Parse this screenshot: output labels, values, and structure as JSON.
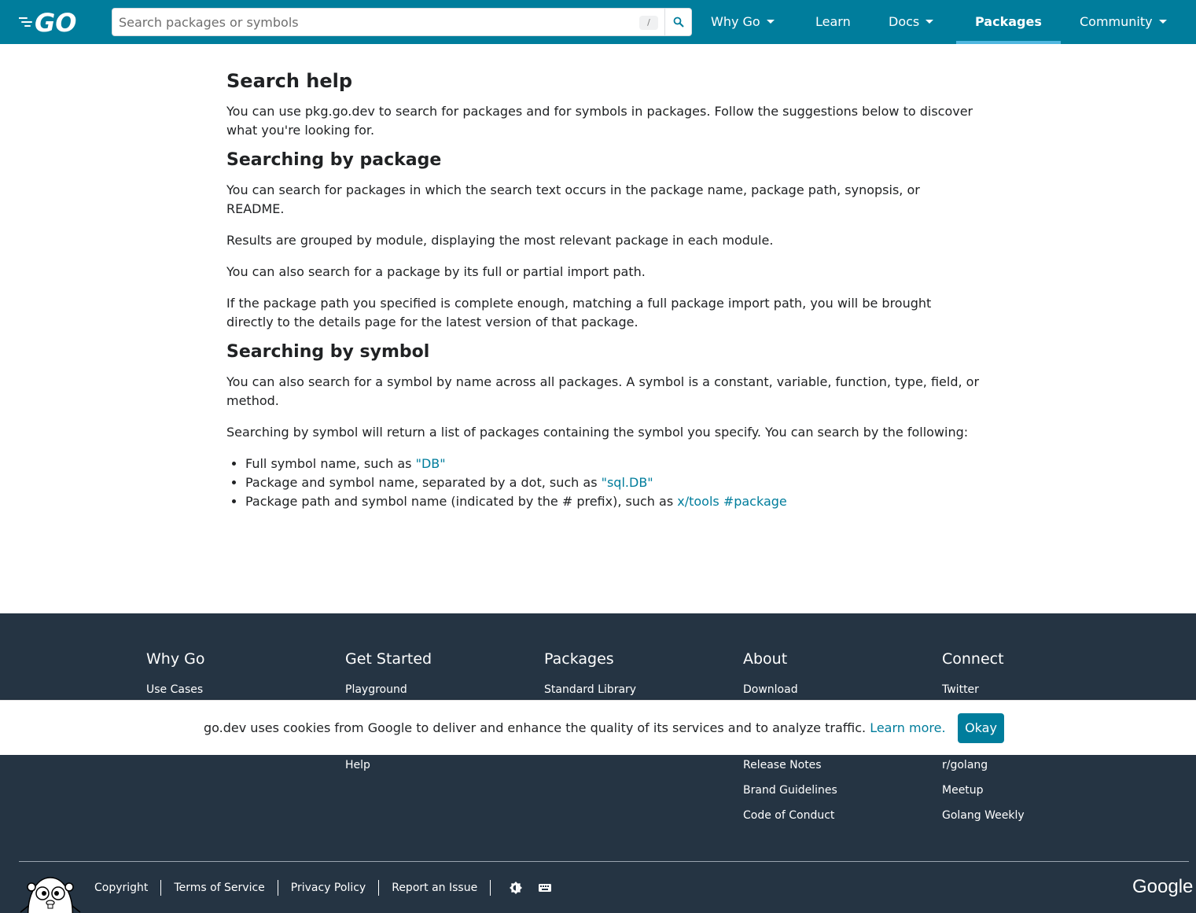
{
  "header": {
    "logo": "GO",
    "search": {
      "placeholder": "Search packages or symbols",
      "shortcut_hint": "/"
    },
    "nav": [
      {
        "label": "Why Go",
        "dropdown": true
      },
      {
        "label": "Learn",
        "dropdown": false
      },
      {
        "label": "Docs",
        "dropdown": true
      },
      {
        "label": "Packages",
        "dropdown": false,
        "active": true
      },
      {
        "label": "Community",
        "dropdown": true
      }
    ]
  },
  "main": {
    "title": "Search help",
    "intro": "You can use pkg.go.dev to search for packages and for symbols in packages. Follow the suggestions below to discover what you're looking for.",
    "pkg_heading": "Searching by package",
    "pkg_p1": "You can search for packages in which the search text occurs in the package name, package path, synopsis, or README.",
    "pkg_p2": "Results are grouped by module, displaying the most relevant package in each module.",
    "pkg_p3": "You can also search for a package by its full or partial import path.",
    "pkg_p4": "If the package path you specified is complete enough, matching a full package import path, you will be brought directly to the details page for the latest version of that package.",
    "sym_heading": "Searching by symbol",
    "sym_p1": "You can also search for a symbol by name across all packages. A symbol is a constant, variable, function, type, field, or method.",
    "sym_p2": "Searching by symbol will return a list of packages containing the symbol you specify. You can search by the following:",
    "sym_list": [
      {
        "text": "Full symbol name, such as ",
        "link": "\"DB\""
      },
      {
        "text": "Package and symbol name, separated by a dot, such as ",
        "link": "\"sql.DB\""
      },
      {
        "text": "Package path and symbol name (indicated by the # prefix), such as ",
        "link": "x/tools #package"
      }
    ]
  },
  "footer": {
    "columns": [
      {
        "title": "Why Go",
        "links": [
          "Use Cases"
        ]
      },
      {
        "title": "Get Started",
        "links": [
          "Playground",
          "Help"
        ]
      },
      {
        "title": "Packages",
        "links": [
          "Standard Library"
        ]
      },
      {
        "title": "About",
        "links": [
          "Download",
          "Release Notes",
          "Brand Guidelines",
          "Code of Conduct"
        ]
      },
      {
        "title": "Connect",
        "links": [
          "Twitter",
          "r/golang",
          "Meetup",
          "Golang Weekly"
        ]
      }
    ],
    "bottom_links": [
      "Copyright",
      "Terms of Service",
      "Privacy Policy",
      "Report an Issue"
    ],
    "google": "Google"
  },
  "cookie": {
    "text": "go.dev uses cookies from Google to deliver and enhance the quality of its services and to analyze traffic.",
    "learn_more": "Learn more.",
    "button": "Okay"
  },
  "colors": {
    "header_bg": "#007d9c",
    "footer_bg": "#253443",
    "link": "#007d9c",
    "accent_underline": "#50b7e0"
  }
}
